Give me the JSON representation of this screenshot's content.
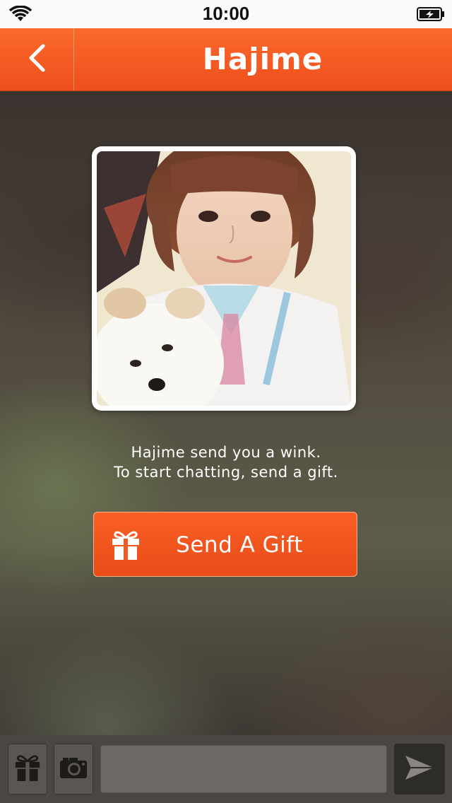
{
  "status_bar": {
    "time": "10:00",
    "wifi_icon": "wifi-icon",
    "battery_icon": "battery-charging-icon"
  },
  "header": {
    "title": "Hajime",
    "back_icon": "chevron-left-icon"
  },
  "main": {
    "message_line1": "Hajime send you a wink.",
    "message_line2": "To start chatting, send a gift.",
    "gift_button_label": "Send A Gift",
    "gift_icon": "gift-icon"
  },
  "toolbar": {
    "gift_icon": "gift-icon",
    "camera_icon": "camera-icon",
    "input_value": "",
    "input_placeholder": "",
    "send_icon": "send-icon"
  },
  "colors": {
    "accent": "#f05a22",
    "header_bg": "#f4561f",
    "toolbar_bg": "#4a4641"
  }
}
